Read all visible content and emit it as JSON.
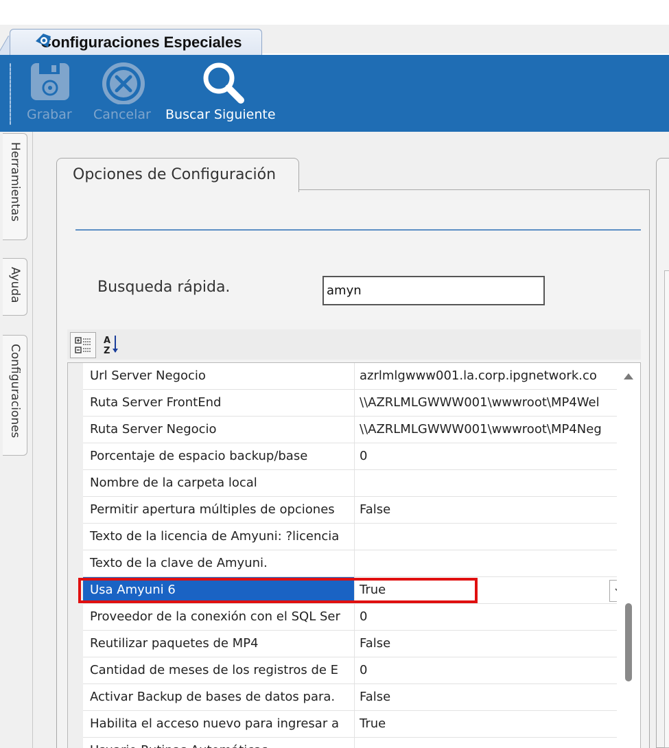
{
  "window": {
    "tab_title": "Configuraciones Especiales"
  },
  "ribbon": {
    "buttons": [
      {
        "label": "Grabar",
        "icon": "floppy-disk-icon",
        "enabled": false
      },
      {
        "label": "Cancelar",
        "icon": "cancel-circle-icon",
        "enabled": false
      },
      {
        "label": "Buscar Siguiente",
        "icon": "magnifier-icon",
        "enabled": true
      }
    ],
    "color": "#1f6db4"
  },
  "side_tabs": [
    "Herramientas",
    "Ayuda",
    "Configuraciones"
  ],
  "panel": {
    "tab_title": "Opciones de Configuración",
    "search": {
      "label": "Busqueda rápida.",
      "value": "amyn"
    }
  },
  "property_grid": {
    "toolbar": {
      "categorized_icon": "categorized-view-icon",
      "alphabetical_icon": "sort-az-icon"
    },
    "rows": [
      {
        "name": "Url Server Negocio",
        "value": "azrlmlgwww001.la.corp.ipgnetwork.co"
      },
      {
        "name": "Ruta Server FrontEnd",
        "value": "\\\\AZRLMLGWWW001\\wwwroot\\MP4Wel"
      },
      {
        "name": "Ruta Server Negocio",
        "value": "\\\\AZRLMLGWWW001\\wwwroot\\MP4Neg"
      },
      {
        "name": "Porcentaje de espacio backup/base",
        "value": "0"
      },
      {
        "name": "Nombre de la carpeta local",
        "value": ""
      },
      {
        "name": "Permitir apertura múltiples de opciones",
        "value": "False"
      },
      {
        "name": "Texto de la licencia de Amyuni: ?licencia",
        "value": ""
      },
      {
        "name": "Texto de la clave de Amyuni.",
        "value": ""
      },
      {
        "name": "Usa Amyuni 6",
        "value": "True",
        "selected": true
      },
      {
        "name": "Proveedor de la conexión con el SQL Ser",
        "value": "0"
      },
      {
        "name": "Reutilizar paquetes de MP4",
        "value": "False"
      },
      {
        "name": "Cantidad de meses de los registros de E",
        "value": "0"
      },
      {
        "name": "Activar Backup de bases de datos para.",
        "value": "False"
      },
      {
        "name": "Habilita el acceso nuevo para ingresar a",
        "value": "True"
      },
      {
        "name": "Usuario Rutinas Automáticas",
        "value": ""
      }
    ]
  },
  "highlight_color": "#e01010",
  "selection_color": "#1a63c4"
}
